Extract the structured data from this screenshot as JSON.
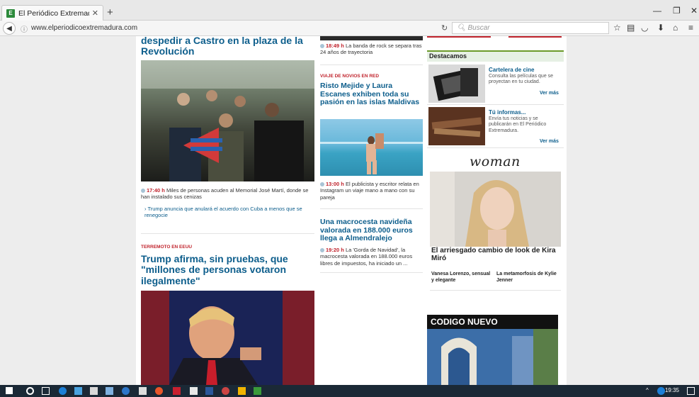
{
  "browser": {
    "tab_title": "El Periódico Extremadura.",
    "tab_close": "✕",
    "new_tab": "+",
    "url": "www.elperiodicoextremadura.com",
    "search_placeholder": "Buscar"
  },
  "left": {
    "lead_headline": "despedir a Castro en la plaza de la Revolución",
    "lead_time": "17:40 h",
    "lead_summary": "Miles de personas acuden al Memorial José Martí, donde se han instalado sus cenizas",
    "related": "Trump anuncia que anulará el acuerdo con Cuba a menos que se renegocie",
    "second_kicker": "TERREMOTO EN EEUU",
    "second_headline": "Trump afirma, sin pruebas, que \"millones de personas votaron ilegalmente\""
  },
  "middle": {
    "top_time": "18:49 h",
    "top_text": "La banda de rock se separa tras 24 años de trayectoria",
    "kicker": "VIAJE DE NOVIOS EN RED",
    "headline": "Risto Mejide y Laura Escanes exhiben toda su pasión en las islas Maldivas",
    "item_time": "13:00 h",
    "item_text": "El publicista y escritor relata en Instagram un viaje mano a mano con su pareja",
    "headline2": "Una macrocesta navideña valorada en 188.000 euros llega a Almendralejo",
    "item2_time": "19:20 h",
    "item2_text": "La 'Gorda de Navidad', la macrocesta valorada en 188.000 euros libres de impuestos, ha iniciado un ..."
  },
  "right": {
    "destacamos": "Destacamos",
    "cartelera_title": "Cartelera de cine",
    "cartelera_desc": "Consulta las películas que se proyectan en tu ciudad.",
    "ver_mas": "Ver más",
    "informas_title": "Tú informas...",
    "informas_desc": "Envía tus noticias y se publicarán en El Periódico Extremadura.",
    "woman_logo": "woman",
    "woman_headline": "El arriesgado cambio de look de Kira Miró",
    "woman_link1": "Vanesa Lorenzo, sensual y elegante",
    "woman_link2": "La metamorfosis de Kylie Jenner",
    "codigo": "CODIGO NUEVO"
  },
  "taskbar": {
    "clock": "19:35"
  },
  "colors": {
    "headline_blue": "#0d5e8c",
    "kicker_red": "#c0232c",
    "taskbar": "#1b2936"
  }
}
